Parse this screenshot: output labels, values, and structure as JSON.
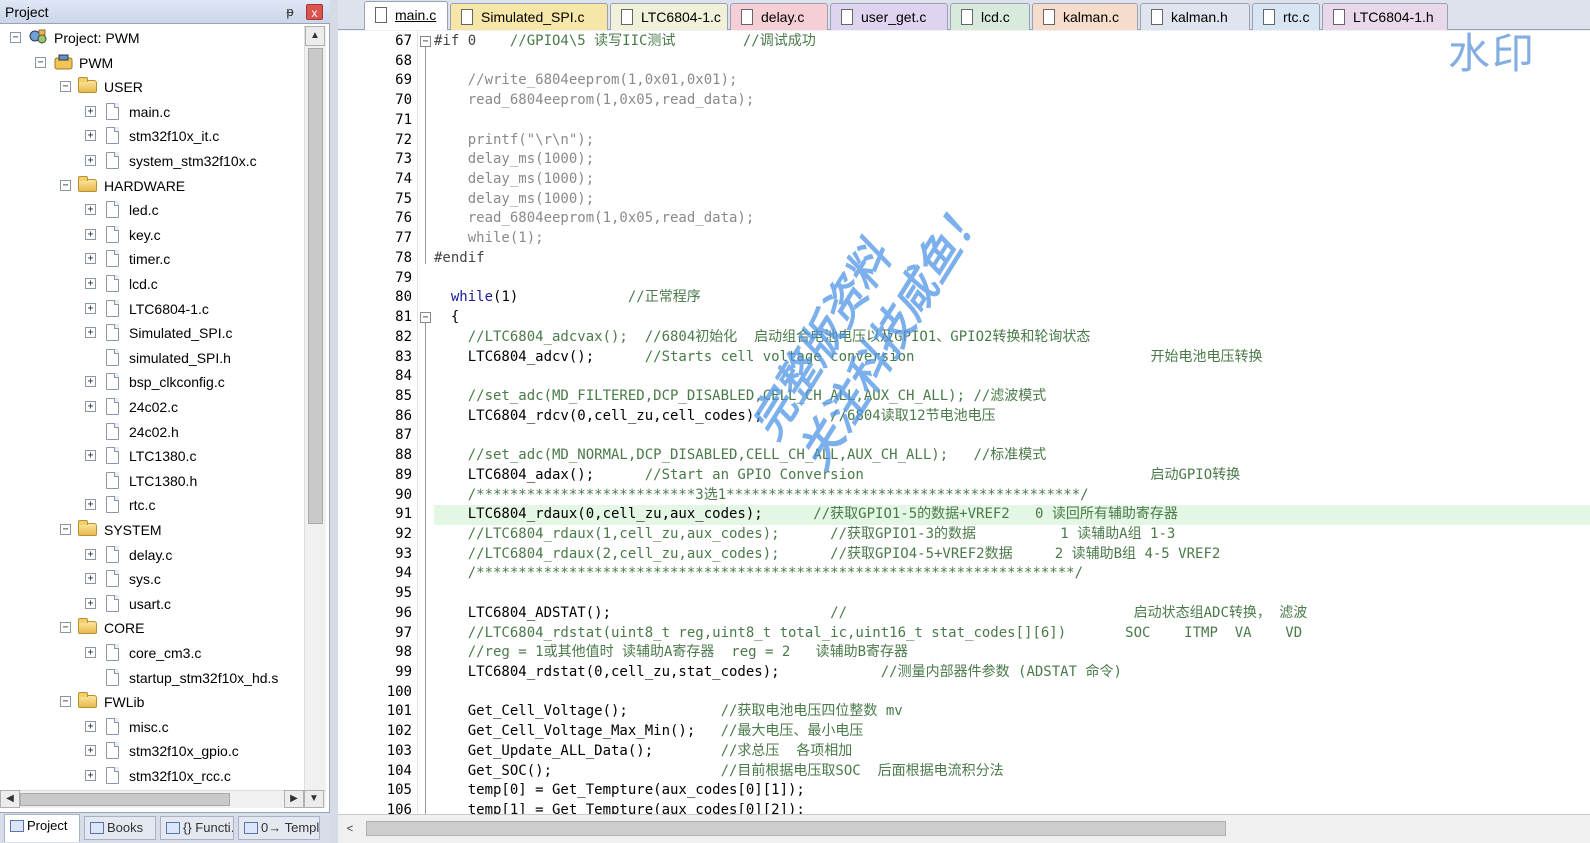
{
  "project_panel": {
    "title": "Project",
    "pin": "ᵽ",
    "close": "x",
    "tree": [
      {
        "label": "Project: PWM",
        "depth": 0,
        "kind": "project",
        "expanded": true
      },
      {
        "label": "PWM",
        "depth": 1,
        "kind": "target",
        "expanded": true
      },
      {
        "label": "USER",
        "depth": 2,
        "kind": "folder",
        "expanded": true
      },
      {
        "label": "main.c",
        "depth": 3,
        "kind": "file",
        "expander": true
      },
      {
        "label": "stm32f10x_it.c",
        "depth": 3,
        "kind": "file",
        "expander": true
      },
      {
        "label": "system_stm32f10x.c",
        "depth": 3,
        "kind": "file",
        "expander": true
      },
      {
        "label": "HARDWARE",
        "depth": 2,
        "kind": "folder",
        "expanded": true
      },
      {
        "label": "led.c",
        "depth": 3,
        "kind": "file",
        "expander": true
      },
      {
        "label": "key.c",
        "depth": 3,
        "kind": "file",
        "expander": true
      },
      {
        "label": "timer.c",
        "depth": 3,
        "kind": "file",
        "expander": true
      },
      {
        "label": "lcd.c",
        "depth": 3,
        "kind": "file",
        "expander": true
      },
      {
        "label": "LTC6804-1.c",
        "depth": 3,
        "kind": "file",
        "expander": true
      },
      {
        "label": "Simulated_SPI.c",
        "depth": 3,
        "kind": "file",
        "expander": true
      },
      {
        "label": "simulated_SPI.h",
        "depth": 3,
        "kind": "file",
        "expander": false
      },
      {
        "label": "bsp_clkconfig.c",
        "depth": 3,
        "kind": "file",
        "expander": true
      },
      {
        "label": "24c02.c",
        "depth": 3,
        "kind": "file",
        "expander": true
      },
      {
        "label": "24c02.h",
        "depth": 3,
        "kind": "file",
        "expander": false
      },
      {
        "label": "LTC1380.c",
        "depth": 3,
        "kind": "file",
        "expander": true
      },
      {
        "label": "LTC1380.h",
        "depth": 3,
        "kind": "file",
        "expander": false
      },
      {
        "label": "rtc.c",
        "depth": 3,
        "kind": "file",
        "expander": true
      },
      {
        "label": "SYSTEM",
        "depth": 2,
        "kind": "folder",
        "expanded": true
      },
      {
        "label": "delay.c",
        "depth": 3,
        "kind": "file",
        "expander": true
      },
      {
        "label": "sys.c",
        "depth": 3,
        "kind": "file",
        "expander": true
      },
      {
        "label": "usart.c",
        "depth": 3,
        "kind": "file",
        "expander": true
      },
      {
        "label": "CORE",
        "depth": 2,
        "kind": "folder",
        "expanded": true
      },
      {
        "label": "core_cm3.c",
        "depth": 3,
        "kind": "file",
        "expander": true
      },
      {
        "label": "startup_stm32f10x_hd.s",
        "depth": 3,
        "kind": "file",
        "expander": false
      },
      {
        "label": "FWLib",
        "depth": 2,
        "kind": "folder",
        "expanded": true
      },
      {
        "label": "misc.c",
        "depth": 3,
        "kind": "file",
        "expander": true
      },
      {
        "label": "stm32f10x_gpio.c",
        "depth": 3,
        "kind": "file",
        "expander": true
      },
      {
        "label": "stm32f10x_rcc.c",
        "depth": 3,
        "kind": "file",
        "expander": true
      }
    ],
    "bottom_tabs": [
      {
        "label": "Project",
        "active": true,
        "icon": "project-icon"
      },
      {
        "label": "Books",
        "active": false,
        "icon": "books-icon"
      },
      {
        "label": "{} Functi...",
        "active": false,
        "icon": "functions-icon"
      },
      {
        "label": "0→ Templ...",
        "active": false,
        "icon": "templates-icon"
      }
    ]
  },
  "editor_tabs": [
    {
      "label": "main.c",
      "active": true,
      "color": "#ffffff"
    },
    {
      "label": "Simulated_SPI.c",
      "active": false,
      "color": "#f6e6a8"
    },
    {
      "label": "LTC6804-1.c",
      "active": false,
      "color": "#f1f1da"
    },
    {
      "label": "delay.c",
      "active": false,
      "color": "#f6cfd6"
    },
    {
      "label": "user_get.c",
      "active": false,
      "color": "#dfd4ef"
    },
    {
      "label": "lcd.c",
      "active": false,
      "color": "#d8eadb"
    },
    {
      "label": "kalman.c",
      "active": false,
      "color": "#f6dccb"
    },
    {
      "label": "kalman.h",
      "active": false,
      "color": "#e0e4ef"
    },
    {
      "label": "rtc.c",
      "active": false,
      "color": "#d8e6f4"
    },
    {
      "label": "LTC6804-1.h",
      "active": false,
      "color": "#e9d8ea"
    }
  ],
  "code": {
    "highlighted_line": 91,
    "lines": [
      {
        "n": "67",
        "fold": "minus",
        "segs": [
          {
            "t": "#if 0    ",
            "c": "pre"
          },
          {
            "t": "//GPIO4\\5 读写IIC测试        //调试成功",
            "c": "comment"
          }
        ]
      },
      {
        "n": "68",
        "segs": []
      },
      {
        "n": "69",
        "segs": [
          {
            "t": "    //write_6804eeprom(1,0x01,0x01);",
            "c": "dim"
          }
        ]
      },
      {
        "n": "70",
        "segs": [
          {
            "t": "    read_6804eeprom(1,0x05,read_data);",
            "c": "dim"
          }
        ]
      },
      {
        "n": "71",
        "segs": []
      },
      {
        "n": "72",
        "segs": [
          {
            "t": "    printf(\"\\r\\n\");",
            "c": "dim"
          }
        ]
      },
      {
        "n": "73",
        "segs": [
          {
            "t": "    delay_ms(1000);",
            "c": "dim"
          }
        ]
      },
      {
        "n": "74",
        "segs": [
          {
            "t": "    delay_ms(1000);",
            "c": "dim"
          }
        ]
      },
      {
        "n": "75",
        "segs": [
          {
            "t": "    delay_ms(1000);",
            "c": "dim"
          }
        ]
      },
      {
        "n": "76",
        "segs": [
          {
            "t": "    read_6804eeprom(1,0x05,read_data);",
            "c": "dim"
          }
        ]
      },
      {
        "n": "77",
        "segs": [
          {
            "t": "    while(1);",
            "c": "dim"
          }
        ]
      },
      {
        "n": "78",
        "segs": [
          {
            "t": "#endif",
            "c": "pre"
          }
        ]
      },
      {
        "n": "79",
        "segs": []
      },
      {
        "n": "80",
        "segs": [
          {
            "t": "  while",
            "c": "kw"
          },
          {
            "t": "(1)             ",
            "c": "code"
          },
          {
            "t": "//正常程序",
            "c": "comment"
          }
        ]
      },
      {
        "n": "81",
        "fold": "minus",
        "segs": [
          {
            "t": "  {",
            "c": "code"
          }
        ]
      },
      {
        "n": "82",
        "segs": [
          {
            "t": "    //LTC6804_adcvax();  //6804初始化  启动组合电池电压以及GPIO1、GPIO2转换和轮询状态",
            "c": "comment"
          }
        ]
      },
      {
        "n": "83",
        "segs": [
          {
            "t": "    LTC6804_adcv();      ",
            "c": "code"
          },
          {
            "t": "//Starts cell voltage conversion                            开始电池电压转换",
            "c": "comment"
          }
        ]
      },
      {
        "n": "84",
        "segs": []
      },
      {
        "n": "85",
        "segs": [
          {
            "t": "    //set_adc(MD_FILTERED,DCP_DISABLED,CELL_CH_ALL,AUX_CH_ALL); //滤波模式",
            "c": "comment"
          }
        ]
      },
      {
        "n": "86",
        "segs": [
          {
            "t": "    LTC6804_rdcv(0,cell_zu,cell_codes);        ",
            "c": "code"
          },
          {
            "t": "//6804读取12节电池电压",
            "c": "comment"
          }
        ]
      },
      {
        "n": "87",
        "segs": []
      },
      {
        "n": "88",
        "segs": [
          {
            "t": "    //set_adc(MD_NORMAL,DCP_DISABLED,CELL_CH_ALL,AUX_CH_ALL);   //标准模式",
            "c": "comment"
          }
        ]
      },
      {
        "n": "89",
        "segs": [
          {
            "t": "    LTC6804_adax();      ",
            "c": "code"
          },
          {
            "t": "//Start an GPIO Conversion                                  启动GPIO转换",
            "c": "comment"
          }
        ]
      },
      {
        "n": "90",
        "segs": [
          {
            "t": "    /**************************3选1******************************************/",
            "c": "comment"
          }
        ]
      },
      {
        "n": "91",
        "segs": [
          {
            "t": "    LTC6804_rdaux(0,cell_zu,aux_codes);      ",
            "c": "code"
          },
          {
            "t": "//获取GPIO1-5的数据+VREF2   0 读回所有辅助寄存器",
            "c": "comment"
          }
        ]
      },
      {
        "n": "92",
        "segs": [
          {
            "t": "    //LTC6804_rdaux(1,cell_zu,aux_codes);      //获取GPIO1-3的数据          1 读辅助A组 1-3",
            "c": "comment"
          }
        ]
      },
      {
        "n": "93",
        "segs": [
          {
            "t": "    //LTC6804_rdaux(2,cell_zu,aux_codes);      //获取GPIO4-5+VREF2数据     2 读辅助B组 4-5 VREF2",
            "c": "comment"
          }
        ]
      },
      {
        "n": "94",
        "segs": [
          {
            "t": "    /***********************************************************************/",
            "c": "comment"
          }
        ]
      },
      {
        "n": "95",
        "segs": []
      },
      {
        "n": "96",
        "segs": [
          {
            "t": "    LTC6804_ADSTAT();                          ",
            "c": "code"
          },
          {
            "t": "//                                  启动状态组ADC转换， 滤波",
            "c": "comment"
          }
        ]
      },
      {
        "n": "97",
        "segs": [
          {
            "t": "    //LTC6804_rdstat(uint8_t reg,uint8_t total_ic,uint16_t stat_codes[][6])       SOC    ITMP  VA    VD",
            "c": "comment"
          }
        ]
      },
      {
        "n": "98",
        "segs": [
          {
            "t": "    //reg = 1或其他值时 读辅助A寄存器  reg = 2   读辅助B寄存器",
            "c": "comment"
          }
        ]
      },
      {
        "n": "99",
        "segs": [
          {
            "t": "    LTC6804_rdstat(0,cell_zu,stat_codes);            ",
            "c": "code"
          },
          {
            "t": "//测量内部器件参数 (ADSTAT 命令)",
            "c": "comment"
          }
        ]
      },
      {
        "n": "100",
        "segs": []
      },
      {
        "n": "101",
        "segs": [
          {
            "t": "    Get_Cell_Voltage();           ",
            "c": "code"
          },
          {
            "t": "//获取电池电压四位整数 mv",
            "c": "comment"
          }
        ]
      },
      {
        "n": "102",
        "segs": [
          {
            "t": "    Get_Cell_Voltage_Max_Min();   ",
            "c": "code"
          },
          {
            "t": "//最大电压、最小电压",
            "c": "comment"
          }
        ]
      },
      {
        "n": "103",
        "segs": [
          {
            "t": "    Get_Update_ALL_Data();        ",
            "c": "code"
          },
          {
            "t": "//求总压  各项相加",
            "c": "comment"
          }
        ]
      },
      {
        "n": "104",
        "segs": [
          {
            "t": "    Get_SOC();                    ",
            "c": "code"
          },
          {
            "t": "//目前根据电压取SOC  后面根据电流积分法",
            "c": "comment"
          }
        ]
      },
      {
        "n": "105",
        "segs": [
          {
            "t": "    temp[0] = Get_Tempture(aux_codes[0][1]);",
            "c": "code"
          }
        ]
      },
      {
        "n": "106",
        "segs": [
          {
            "t": "    temp[1] = Get_Tempture(aux_codes[0][2]);",
            "c": "code"
          }
        ]
      }
    ]
  },
  "watermarks": {
    "top_right": "水印",
    "diagonal_line1": "完整版资料",
    "diagonal_line2": "关注科技咸鱼！"
  },
  "scroll": {
    "left_arrow": "◀",
    "right_arrow": "▶",
    "up_arrow": "▲",
    "down_arrow": "▼",
    "editor_left": "<"
  }
}
